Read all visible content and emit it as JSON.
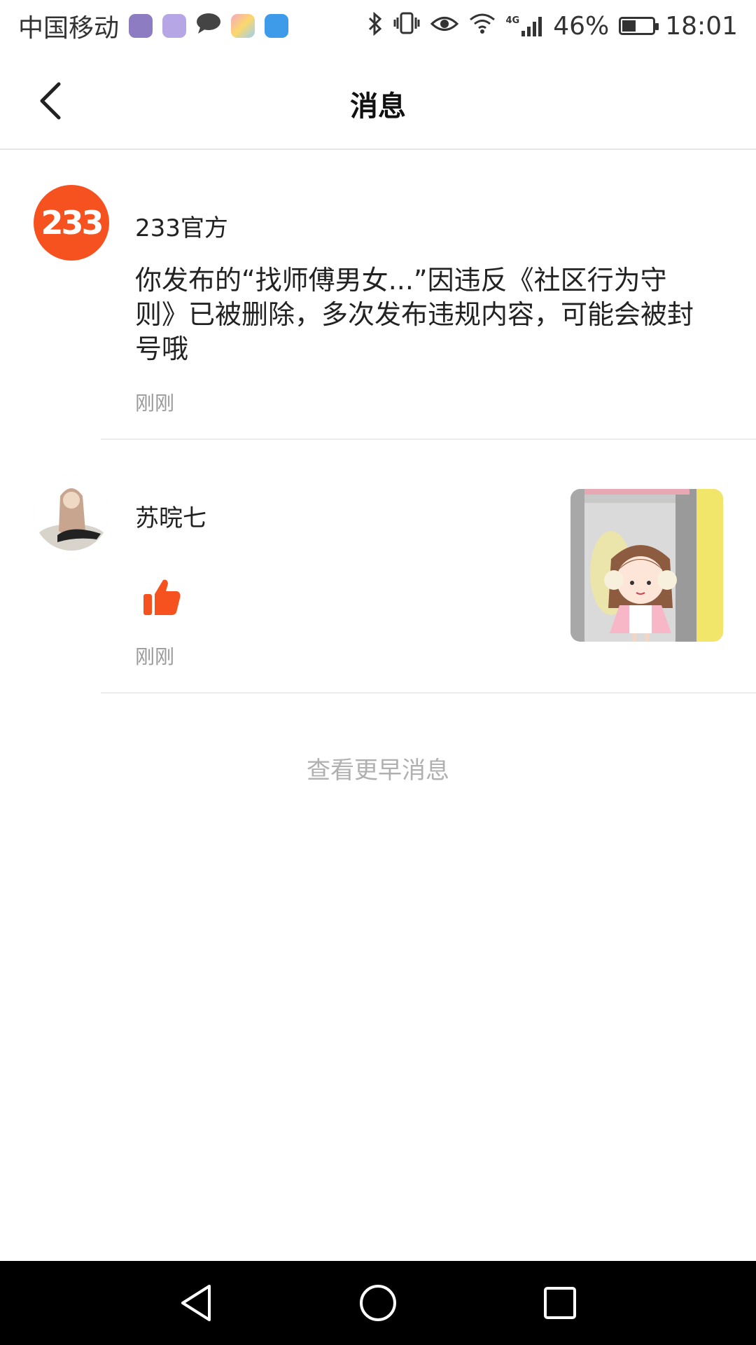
{
  "status_bar": {
    "carrier": "中国移动",
    "network": "4G",
    "battery": "46%",
    "battery_level": 0.46,
    "time": "18:01"
  },
  "header": {
    "title": "消息",
    "back_icon": "chevron-left-icon"
  },
  "messages": [
    {
      "sender": "233官方",
      "avatar_text": "233",
      "avatar_color": "#f5521f",
      "text": "你发布的“找师傅男女...”因违反《社区行为守则》已被删除，多次发布违规内容，可能会被封号哦",
      "time": "刚刚"
    },
    {
      "sender": "苏晥七",
      "icon": "thumbs-up-icon",
      "icon_color": "#f5521f",
      "time": "刚刚"
    }
  ],
  "more_link": "查看更早消息",
  "colors": {
    "accent": "#f5521f",
    "muted": "#9a9a9a",
    "divider": "#ececec"
  }
}
